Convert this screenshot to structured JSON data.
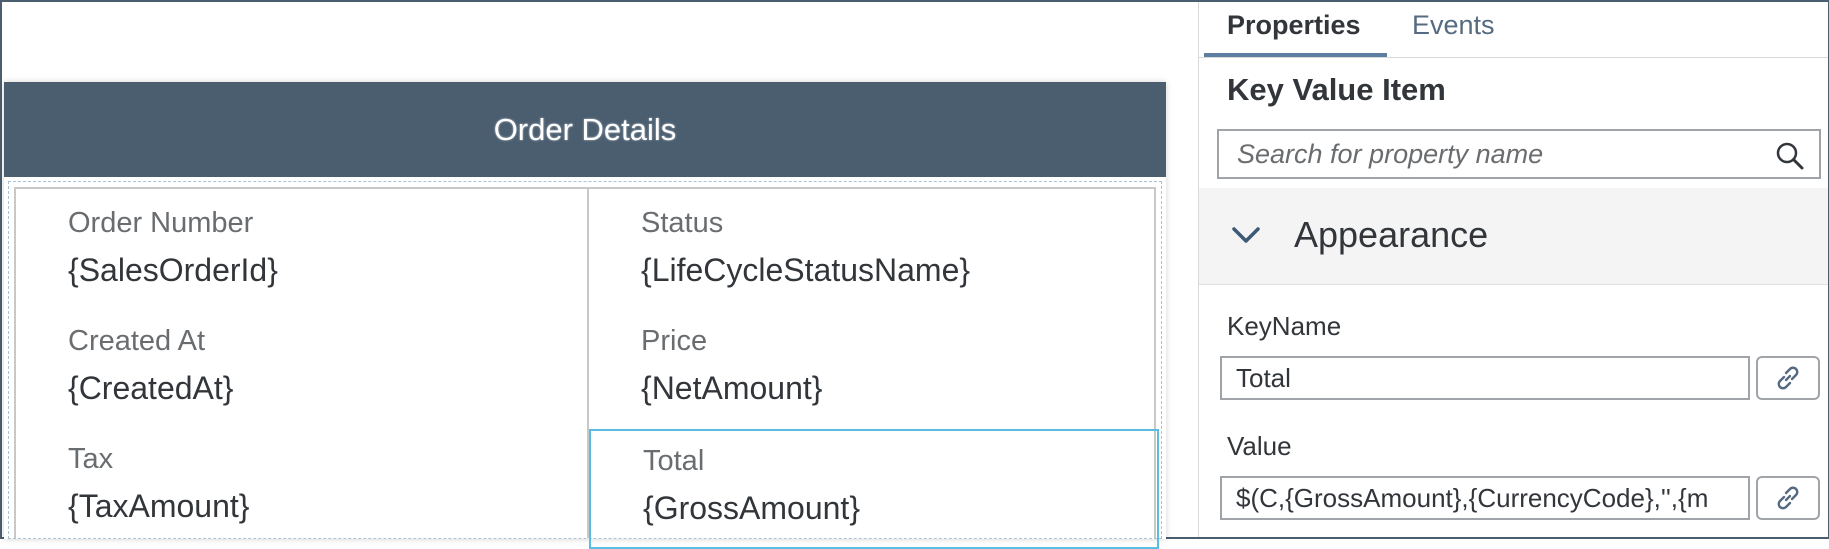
{
  "canvas": {
    "card_title": "Order Details",
    "items": [
      {
        "key": "Order Number",
        "value": "{SalesOrderId}"
      },
      {
        "key": "Status",
        "value": "{LifeCycleStatusName}"
      },
      {
        "key": "Created At",
        "value": "{CreatedAt}"
      },
      {
        "key": "Price",
        "value": "{NetAmount}"
      },
      {
        "key": "Tax",
        "value": "{TaxAmount}"
      },
      {
        "key": "Total",
        "value": "{GrossAmount}"
      }
    ]
  },
  "panel": {
    "tabs": [
      {
        "label": "Properties",
        "active": true
      },
      {
        "label": "Events",
        "active": false
      }
    ],
    "title": "Key Value Item",
    "search": {
      "placeholder": "Search for property name",
      "icon": "search-icon"
    },
    "section": {
      "title": "Appearance",
      "icon": "chevron-down-icon"
    },
    "fields": [
      {
        "label": "KeyName",
        "value": "Total",
        "bind_icon": "link-icon"
      },
      {
        "label": "Value",
        "value": "$(C,{GrossAmount},{CurrencyCode},'',{m",
        "bind_icon": "link-icon"
      }
    ]
  },
  "colors": {
    "header_bg": "#4a5e70",
    "selection_border": "#5bbde0",
    "tab_underline": "#5c7ea0"
  }
}
